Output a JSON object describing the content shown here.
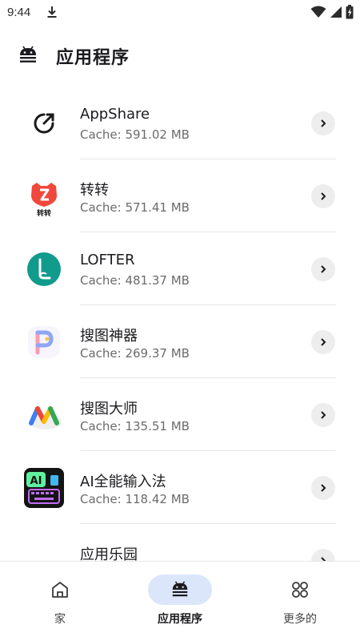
{
  "status_bar": {
    "time": "9:44",
    "icons": [
      "download-icon",
      "wifi-icon",
      "signal-icon",
      "battery-icon"
    ]
  },
  "app_bar": {
    "icon": "android-icon",
    "title": "应用程序"
  },
  "apps": [
    {
      "name": "AppShare",
      "cache": "Cache: 591.02 MB",
      "icon": "appshare-icon"
    },
    {
      "name": "转转",
      "cache": "Cache: 571.41 MB",
      "icon": "zhuanzhuan-icon",
      "icon_label": "转转"
    },
    {
      "name": "LOFTER",
      "cache": "Cache: 481.37 MB",
      "icon": "lofter-icon"
    },
    {
      "name": "搜图神器",
      "cache": "Cache: 269.37 MB",
      "icon": "soutu-shenqi-icon"
    },
    {
      "name": "搜图大师",
      "cache": "Cache: 135.51 MB",
      "icon": "soutu-dashi-icon"
    },
    {
      "name": "AI全能输入法",
      "cache": "Cache: 118.42 MB",
      "icon": "ai-keyboard-icon",
      "icon_label": "AI"
    },
    {
      "name": "应用乐园",
      "cache": "",
      "icon": "app-paradise-icon"
    }
  ],
  "bottom_nav": {
    "items": [
      {
        "label": "家",
        "icon": "home-icon",
        "active": false
      },
      {
        "label": "应用程序",
        "icon": "android-icon",
        "active": true
      },
      {
        "label": "更多的",
        "icon": "grid-icon",
        "active": false
      }
    ]
  },
  "colors": {
    "active_nav_pill": "#dbe6fb",
    "chevron_bg": "#ededed",
    "zhuanzhuan_red": "#f0483c",
    "lofter_teal": "#119b8c",
    "ai_keyboard_bg": "#141414"
  }
}
